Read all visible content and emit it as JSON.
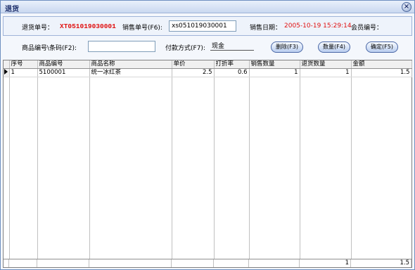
{
  "window": {
    "title": "退货",
    "close_icon": "close-icon"
  },
  "header": {
    "return_no_label": "退货单号：",
    "return_no_value": "XT051019030001",
    "sales_no_label": "销售单号(F6):",
    "sales_no_value": "xs051019030001",
    "sales_date_label": "销售日期：",
    "sales_date_value": "2005-10-19 15:29:14",
    "member_no_label": "会员编号："
  },
  "filter": {
    "product_code_label": "商品编号\\条码(F2):",
    "product_code_value": "",
    "payment_label": "付款方式(F7):",
    "payment_value": "现金",
    "delete_button": "删除(F3)",
    "quantity_button": "数量(F4)",
    "confirm_button": "确定(F5)"
  },
  "grid": {
    "columns": [
      "序号",
      "商品编号",
      "商品名称",
      "单价",
      "打折率",
      "销售数量",
      "退货数量",
      "金额"
    ],
    "rows": [
      {
        "seq": "1",
        "code": "5100001",
        "name": "统一冰红茶",
        "price": "2.5",
        "discount": "0.6",
        "sold_qty": "1",
        "return_qty": "1",
        "amount": "1.5"
      }
    ],
    "footer": {
      "return_qty_total": "1",
      "amount_total": "1.5"
    }
  }
}
